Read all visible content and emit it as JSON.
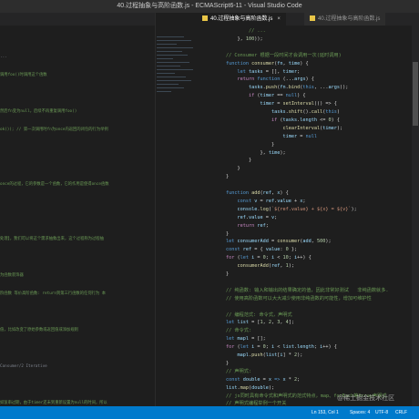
{
  "window": {
    "title": "40.过程抽象与高阶函数.js - ECMAScript6-11 - Visual Studio Code"
  },
  "tabs": [
    {
      "label": "40.过程抽象与高阶函数.js",
      "active": true
    },
    {
      "label": "40.过程抽象与高阶函数.js",
      "active": false
    }
  ],
  "left_pane": {
    "lines": [
      {
        "text": "...",
        "style": "muted"
      },
      {
        "text": "调用foo()时调用这个函数",
        "style": "cm"
      },
      {
        "text": "",
        "style": "muted"
      },
      {
        "text": "然后fn变为null，后续不再重复调用foo()",
        "style": "cm"
      },
      {
        "text": "ok()); //  第一次调用时fn为once内返回的闭包的行为举例",
        "style": "cm"
      },
      {
        "text": "",
        "style": "muted"
      },
      {
        "text": "",
        "style": "muted"
      },
      {
        "text": "once的过程，它的参数是一个函数，它的作用是使得once函数",
        "style": "cm"
      },
      {
        "text": "",
        "style": "muted"
      },
      {
        "text": "",
        "style": "muted"
      },
      {
        "text": "处理】，我们可以将这个需求抽象出来，这个过程称为过程抽",
        "style": "cm"
      },
      {
        "text": "",
        "style": "muted"
      },
      {
        "text": "为函数装饰器",
        "style": "cm"
      },
      {
        "text": "阶函数    等价高阶函数: return到第三行函数的任何行为 本",
        "style": "cm"
      },
      {
        "text": "",
        "style": "muted"
      },
      {
        "text": "值，比如改变了原始参数或返回值或添加规则",
        "style": "cm"
      },
      {
        "text": "",
        "style": "muted"
      },
      {
        "text": "Consumer/2 Iterative",
        "style": "muted"
      },
      {
        "text": "",
        "style": "muted"
      },
      {
        "text": "如饭串过期，由于timer还未到重新设置为null的时间，所以",
        "style": "cm"
      }
    ]
  },
  "editor": {
    "lines": [
      [
        {
          "t": "        ",
          "c": "pun"
        },
        {
          "t": "// ...",
          "c": "cm"
        }
      ],
      [
        {
          "t": "    }, ",
          "c": "pun"
        },
        {
          "t": "100",
          "c": "num"
        },
        {
          "t": "));",
          "c": "pun"
        }
      ],
      [
        {
          "t": "",
          "c": "pun"
        }
      ],
      [
        {
          "t": "// Consumer 根据一段时间才会调用一次(延时调用)",
          "c": "cm"
        }
      ],
      [
        {
          "t": "function ",
          "c": "kw"
        },
        {
          "t": "consumer",
          "c": "fn"
        },
        {
          "t": "(",
          "c": "pun"
        },
        {
          "t": "fn",
          "c": "var"
        },
        {
          "t": ", ",
          "c": "pun"
        },
        {
          "t": "time",
          "c": "var"
        },
        {
          "t": ") {",
          "c": "pun"
        }
      ],
      [
        {
          "t": "    ",
          "c": "pun"
        },
        {
          "t": "let ",
          "c": "kw"
        },
        {
          "t": "tasks",
          "c": "var"
        },
        {
          "t": " = [], ",
          "c": "pun"
        },
        {
          "t": "timer",
          "c": "var"
        },
        {
          "t": ";",
          "c": "pun"
        }
      ],
      [
        {
          "t": "    ",
          "c": "pun"
        },
        {
          "t": "return ",
          "c": "ctl"
        },
        {
          "t": "function ",
          "c": "kw"
        },
        {
          "t": "(...",
          "c": "pun"
        },
        {
          "t": "args",
          "c": "var"
        },
        {
          "t": ") {",
          "c": "pun"
        }
      ],
      [
        {
          "t": "        ",
          "c": "pun"
        },
        {
          "t": "tasks",
          "c": "var"
        },
        {
          "t": ".",
          "c": "pun"
        },
        {
          "t": "push",
          "c": "fn"
        },
        {
          "t": "(",
          "c": "pun"
        },
        {
          "t": "fn",
          "c": "var"
        },
        {
          "t": ".",
          "c": "pun"
        },
        {
          "t": "bind",
          "c": "fn"
        },
        {
          "t": "(",
          "c": "pun"
        },
        {
          "t": "this",
          "c": "kw"
        },
        {
          "t": ", ...",
          "c": "pun"
        },
        {
          "t": "args",
          "c": "var"
        },
        {
          "t": "));",
          "c": "pun"
        }
      ],
      [
        {
          "t": "        ",
          "c": "pun"
        },
        {
          "t": "if ",
          "c": "ctl"
        },
        {
          "t": "(",
          "c": "pun"
        },
        {
          "t": "timer",
          "c": "var"
        },
        {
          "t": " == ",
          "c": "pun"
        },
        {
          "t": "null",
          "c": "kw"
        },
        {
          "t": ") {",
          "c": "pun"
        }
      ],
      [
        {
          "t": "            ",
          "c": "pun"
        },
        {
          "t": "timer",
          "c": "var"
        },
        {
          "t": " = ",
          "c": "pun"
        },
        {
          "t": "setInterval",
          "c": "fn"
        },
        {
          "t": "(() => {",
          "c": "pun"
        }
      ],
      [
        {
          "t": "                ",
          "c": "pun"
        },
        {
          "t": "tasks",
          "c": "var"
        },
        {
          "t": ".",
          "c": "pun"
        },
        {
          "t": "shift",
          "c": "fn"
        },
        {
          "t": "().",
          "c": "pun"
        },
        {
          "t": "call",
          "c": "fn"
        },
        {
          "t": "(",
          "c": "pun"
        },
        {
          "t": "this",
          "c": "kw"
        },
        {
          "t": ")",
          "c": "pun"
        }
      ],
      [
        {
          "t": "                ",
          "c": "pun"
        },
        {
          "t": "if ",
          "c": "ctl"
        },
        {
          "t": "(",
          "c": "pun"
        },
        {
          "t": "tasks",
          "c": "var"
        },
        {
          "t": ".",
          "c": "pun"
        },
        {
          "t": "length",
          "c": "var"
        },
        {
          "t": " <= ",
          "c": "pun"
        },
        {
          "t": "0",
          "c": "num"
        },
        {
          "t": ") {",
          "c": "pun"
        }
      ],
      [
        {
          "t": "                    ",
          "c": "pun"
        },
        {
          "t": "clearInterval",
          "c": "fn"
        },
        {
          "t": "(",
          "c": "pun"
        },
        {
          "t": "timer",
          "c": "var"
        },
        {
          "t": ");",
          "c": "pun"
        }
      ],
      [
        {
          "t": "                    ",
          "c": "pun"
        },
        {
          "t": "timer",
          "c": "var"
        },
        {
          "t": " = ",
          "c": "pun"
        },
        {
          "t": "null",
          "c": "kw"
        }
      ],
      [
        {
          "t": "                }",
          "c": "pun"
        }
      ],
      [
        {
          "t": "            }, ",
          "c": "pun"
        },
        {
          "t": "time",
          "c": "var"
        },
        {
          "t": ");",
          "c": "pun"
        }
      ],
      [
        {
          "t": "        }",
          "c": "pun"
        }
      ],
      [
        {
          "t": "    }",
          "c": "pun"
        }
      ],
      [
        {
          "t": "}",
          "c": "pun"
        }
      ],
      [
        {
          "t": "",
          "c": "pun"
        }
      ],
      [
        {
          "t": "function ",
          "c": "kw"
        },
        {
          "t": "add",
          "c": "fn"
        },
        {
          "t": "(",
          "c": "pun"
        },
        {
          "t": "ref",
          "c": "var"
        },
        {
          "t": ", ",
          "c": "pun"
        },
        {
          "t": "x",
          "c": "var"
        },
        {
          "t": ") {",
          "c": "pun"
        }
      ],
      [
        {
          "t": "    ",
          "c": "pun"
        },
        {
          "t": "const ",
          "c": "kw"
        },
        {
          "t": "v",
          "c": "var"
        },
        {
          "t": " = ",
          "c": "pun"
        },
        {
          "t": "ref",
          "c": "var"
        },
        {
          "t": ".",
          "c": "pun"
        },
        {
          "t": "value",
          "c": "var"
        },
        {
          "t": " + ",
          "c": "pun"
        },
        {
          "t": "x",
          "c": "var"
        },
        {
          "t": ";",
          "c": "pun"
        }
      ],
      [
        {
          "t": "    ",
          "c": "pun"
        },
        {
          "t": "console",
          "c": "var"
        },
        {
          "t": ".",
          "c": "pun"
        },
        {
          "t": "log",
          "c": "fn"
        },
        {
          "t": "(",
          "c": "pun"
        },
        {
          "t": "`${ref.value} + ${x} = ${v}`",
          "c": "str"
        },
        {
          "t": ");",
          "c": "pun"
        }
      ],
      [
        {
          "t": "    ",
          "c": "pun"
        },
        {
          "t": "ref",
          "c": "var"
        },
        {
          "t": ".",
          "c": "pun"
        },
        {
          "t": "value",
          "c": "var"
        },
        {
          "t": " = ",
          "c": "pun"
        },
        {
          "t": "v",
          "c": "var"
        },
        {
          "t": ";",
          "c": "pun"
        }
      ],
      [
        {
          "t": "    ",
          "c": "pun"
        },
        {
          "t": "return ",
          "c": "ctl"
        },
        {
          "t": "ref",
          "c": "var"
        },
        {
          "t": ";",
          "c": "pun"
        }
      ],
      [
        {
          "t": "}",
          "c": "pun"
        }
      ],
      [
        {
          "t": "let ",
          "c": "kw"
        },
        {
          "t": "consumerAdd",
          "c": "var"
        },
        {
          "t": " = ",
          "c": "pun"
        },
        {
          "t": "consumer",
          "c": "fn"
        },
        {
          "t": "(",
          "c": "pun"
        },
        {
          "t": "add",
          "c": "var"
        },
        {
          "t": ", ",
          "c": "pun"
        },
        {
          "t": "500",
          "c": "num"
        },
        {
          "t": ");",
          "c": "pun"
        }
      ],
      [
        {
          "t": "const ",
          "c": "kw"
        },
        {
          "t": "ref",
          "c": "var"
        },
        {
          "t": " = { ",
          "c": "pun"
        },
        {
          "t": "value",
          "c": "var"
        },
        {
          "t": ": ",
          "c": "pun"
        },
        {
          "t": "0",
          "c": "num"
        },
        {
          "t": " };",
          "c": "pun"
        }
      ],
      [
        {
          "t": "for ",
          "c": "ctl"
        },
        {
          "t": "(",
          "c": "pun"
        },
        {
          "t": "let ",
          "c": "kw"
        },
        {
          "t": "i",
          "c": "var"
        },
        {
          "t": " = ",
          "c": "pun"
        },
        {
          "t": "0",
          "c": "num"
        },
        {
          "t": "; ",
          "c": "pun"
        },
        {
          "t": "i",
          "c": "var"
        },
        {
          "t": " < ",
          "c": "pun"
        },
        {
          "t": "10",
          "c": "num"
        },
        {
          "t": "; ",
          "c": "pun"
        },
        {
          "t": "i",
          "c": "var"
        },
        {
          "t": "++) {",
          "c": "pun"
        }
      ],
      [
        {
          "t": "    ",
          "c": "pun"
        },
        {
          "t": "consumerAdd",
          "c": "fn"
        },
        {
          "t": "(",
          "c": "pun"
        },
        {
          "t": "ref",
          "c": "var"
        },
        {
          "t": ", ",
          "c": "pun"
        },
        {
          "t": "1",
          "c": "num"
        },
        {
          "t": ");",
          "c": "pun"
        }
      ],
      [
        {
          "t": "}",
          "c": "pun"
        }
      ],
      [
        {
          "t": "",
          "c": "pun"
        }
      ],
      [
        {
          "t": "// 纯函数: 输入和输出的结果确定的值，因此非常好测试   非纯函数就多.",
          "c": "cm"
        }
      ],
      [
        {
          "t": "// 使用高阶函数可以大大减少使用非纯函数的可能性，增加可维护性",
          "c": "cm"
        }
      ],
      [
        {
          "t": "",
          "c": "pun"
        }
      ],
      [
        {
          "t": "// 编程范式: 命令式，声明式",
          "c": "cm"
        }
      ],
      [
        {
          "t": "let ",
          "c": "kw"
        },
        {
          "t": "list",
          "c": "var"
        },
        {
          "t": " = [",
          "c": "pun"
        },
        {
          "t": "1",
          "c": "num"
        },
        {
          "t": ", ",
          "c": "pun"
        },
        {
          "t": "2",
          "c": "num"
        },
        {
          "t": ", ",
          "c": "pun"
        },
        {
          "t": "3",
          "c": "num"
        },
        {
          "t": ", ",
          "c": "pun"
        },
        {
          "t": "4",
          "c": "num"
        },
        {
          "t": "];",
          "c": "pun"
        }
      ],
      [
        {
          "t": "// 命令式:",
          "c": "cm"
        }
      ],
      [
        {
          "t": "let ",
          "c": "kw"
        },
        {
          "t": "mapl",
          "c": "var"
        },
        {
          "t": " = [];",
          "c": "pun"
        }
      ],
      [
        {
          "t": "for ",
          "c": "ctl"
        },
        {
          "t": "(",
          "c": "pun"
        },
        {
          "t": "let ",
          "c": "kw"
        },
        {
          "t": "i",
          "c": "var"
        },
        {
          "t": " = ",
          "c": "pun"
        },
        {
          "t": "0",
          "c": "num"
        },
        {
          "t": "; ",
          "c": "pun"
        },
        {
          "t": "i",
          "c": "var"
        },
        {
          "t": " < ",
          "c": "pun"
        },
        {
          "t": "list",
          "c": "var"
        },
        {
          "t": ".",
          "c": "pun"
        },
        {
          "t": "length",
          "c": "var"
        },
        {
          "t": "; ",
          "c": "pun"
        },
        {
          "t": "i",
          "c": "var"
        },
        {
          "t": "++) {",
          "c": "pun"
        }
      ],
      [
        {
          "t": "    ",
          "c": "pun"
        },
        {
          "t": "mapl",
          "c": "var"
        },
        {
          "t": ".",
          "c": "pun"
        },
        {
          "t": "push",
          "c": "fn"
        },
        {
          "t": "(",
          "c": "pun"
        },
        {
          "t": "list",
          "c": "var"
        },
        {
          "t": "[",
          "c": "pun"
        },
        {
          "t": "i",
          "c": "var"
        },
        {
          "t": "] * ",
          "c": "pun"
        },
        {
          "t": "2",
          "c": "num"
        },
        {
          "t": ");",
          "c": "pun"
        }
      ],
      [
        {
          "t": "}",
          "c": "pun"
        }
      ],
      [
        {
          "t": "// 声明式:",
          "c": "cm"
        }
      ],
      [
        {
          "t": "const ",
          "c": "kw"
        },
        {
          "t": "double",
          "c": "var"
        },
        {
          "t": " = ",
          "c": "pun"
        },
        {
          "t": "x",
          "c": "var"
        },
        {
          "t": " => ",
          "c": "kw"
        },
        {
          "t": "x",
          "c": "var"
        },
        {
          "t": " * ",
          "c": "pun"
        },
        {
          "t": "2",
          "c": "num"
        },
        {
          "t": ";",
          "c": "pun"
        }
      ],
      [
        {
          "t": "list",
          "c": "var"
        },
        {
          "t": ".",
          "c": "pun"
        },
        {
          "t": "map",
          "c": "fn"
        },
        {
          "t": "(",
          "c": "pun"
        },
        {
          "t": "double",
          "c": "var"
        },
        {
          "t": ");",
          "c": "pun"
        }
      ],
      [
        {
          "t": "// js同时具有命令式和声明式的范式特点，map、forEach等Array声明式",
          "c": "cm"
        }
      ],
      [
        {
          "t": "// 声明式编程举例一个开关",
          "c": "cm"
        }
      ],
      [
        {
          "t": "function ",
          "c": "kw"
        },
        {
          "t": "toggle",
          "c": "fn"
        },
        {
          "t": "(...",
          "c": "pun"
        },
        {
          "t": "actions",
          "c": "var"
        },
        {
          "t": ") {",
          "c": "pun"
        }
      ]
    ]
  },
  "status_bar": {
    "position": "Ln 153, Col 1",
    "spaces": "Spaces: 4",
    "encoding": "UTF-8",
    "eol": "CRLF",
    "language": "JavaScript"
  },
  "watermark": "@稀土掘金技术社区"
}
